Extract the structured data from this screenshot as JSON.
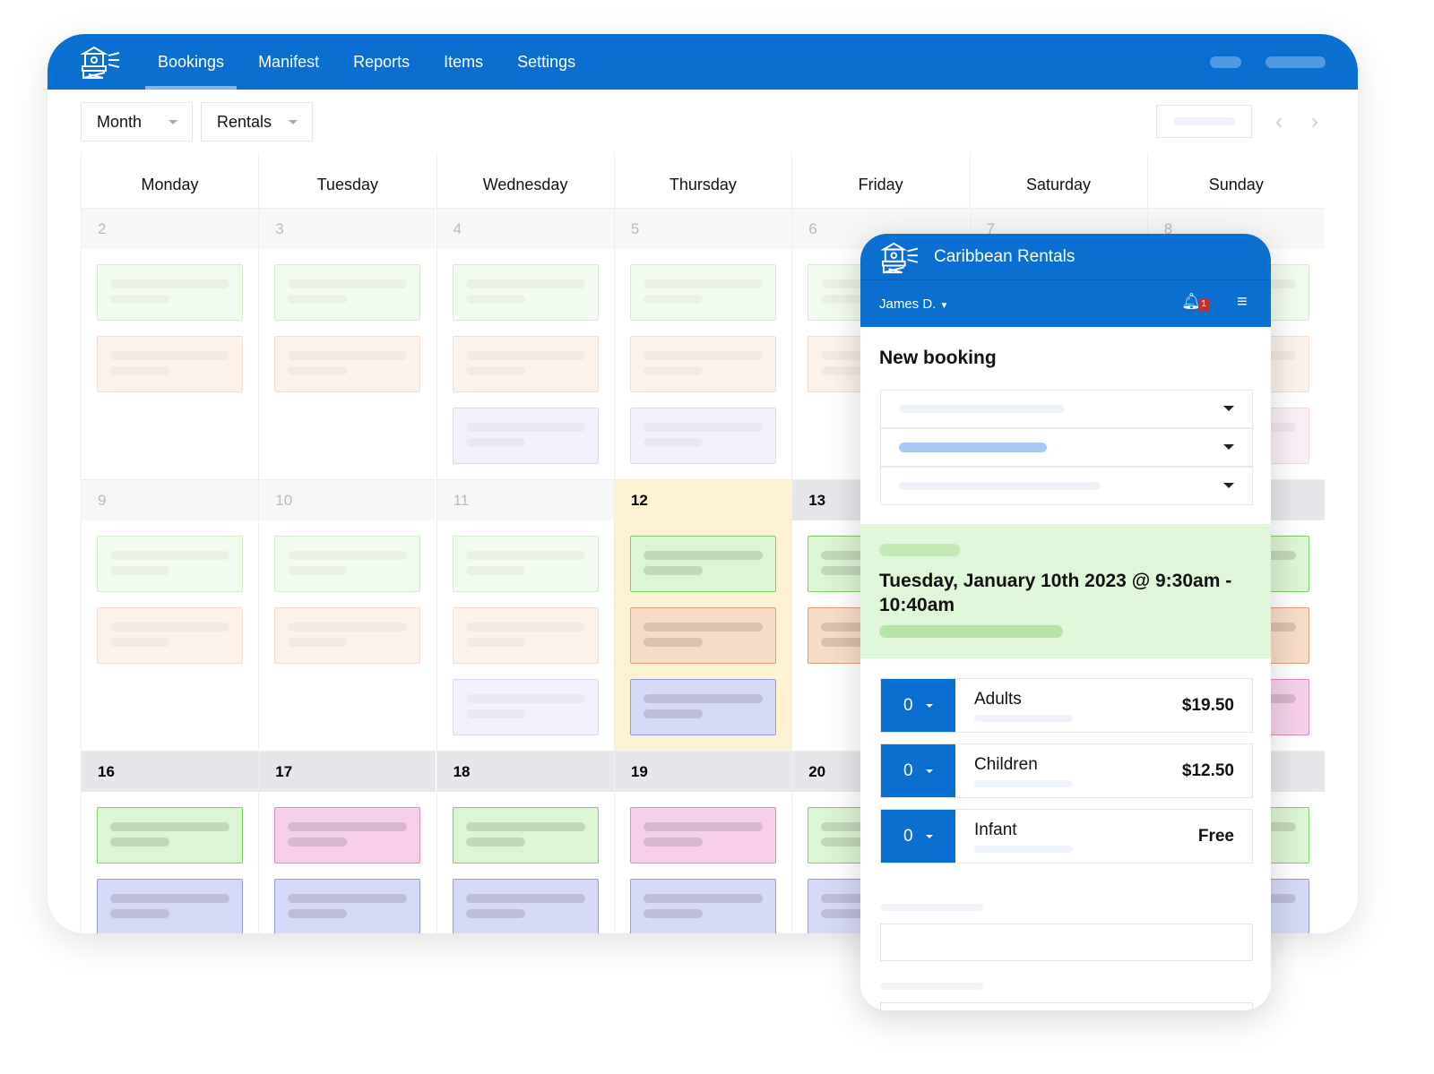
{
  "app": {
    "nav": [
      {
        "label": "Bookings",
        "active": true
      },
      {
        "label": "Manifest"
      },
      {
        "label": "Reports"
      },
      {
        "label": "Items"
      },
      {
        "label": "Settings"
      }
    ],
    "view_select": "Month",
    "category_select": "Rentals"
  },
  "calendar": {
    "weekdays": [
      "Monday",
      "Tuesday",
      "Wednesday",
      "Thursday",
      "Friday",
      "Saturday",
      "Sunday"
    ],
    "today": "12",
    "weeks": [
      {
        "days": [
          "2",
          "3",
          "4",
          "5",
          "6",
          "7",
          "8"
        ],
        "faded": true,
        "events": [
          [
            "green",
            "orange"
          ],
          [
            "green",
            "orange"
          ],
          [
            "green",
            "orange",
            "purple"
          ],
          [
            "green",
            "orange",
            "purple"
          ],
          [
            "green",
            "orange"
          ],
          [],
          [
            "green",
            "orange",
            "pink"
          ]
        ]
      },
      {
        "days": [
          "9",
          "10",
          "11",
          "12",
          "13",
          "",
          ""
        ],
        "faded_days": [
          0,
          1,
          2
        ],
        "events": [
          [
            "green",
            "orange"
          ],
          [
            "green",
            "orange"
          ],
          [
            "green",
            "orange",
            "purple"
          ],
          [
            "green",
            "orange",
            "purple"
          ],
          [
            "green",
            "orange"
          ],
          [],
          [
            "green",
            "orange",
            "pink"
          ]
        ]
      },
      {
        "days": [
          "16",
          "17",
          "18",
          "19",
          "20",
          "",
          ""
        ],
        "events": [
          [
            "green",
            "purple"
          ],
          [
            "pink",
            "purple"
          ],
          [
            "green",
            "purple"
          ],
          [
            "pink",
            "purple"
          ],
          [
            "green",
            "purple"
          ],
          [],
          [
            "green",
            "purple"
          ]
        ]
      }
    ],
    "colors": {
      "green": [
        "#dcf5d3",
        "#7fcc6a"
      ],
      "orange": [
        "#f9dcc6",
        "#dea07a"
      ],
      "purple": [
        "#d6d9f7",
        "#9299e0"
      ],
      "pink": [
        "#f6d0ea",
        "#dc8ac0"
      ]
    }
  },
  "panel": {
    "brand": "Caribbean Rentals",
    "user": "James D.",
    "notification_count": "1",
    "title": "New booking",
    "datetime": "Tuesday, January 10th 2023 @ 9:30am - 10:40am",
    "tickets": [
      {
        "qty": "0",
        "name": "Adults",
        "price": "$19.50"
      },
      {
        "qty": "0",
        "name": "Children",
        "price": "$12.50"
      },
      {
        "qty": "0",
        "name": "Infant",
        "price": "Free"
      }
    ]
  },
  "colors": {
    "brand_blue": "#0a6fd1",
    "today": "#fdf3d3",
    "highlight_green": "#e0f6d8"
  }
}
